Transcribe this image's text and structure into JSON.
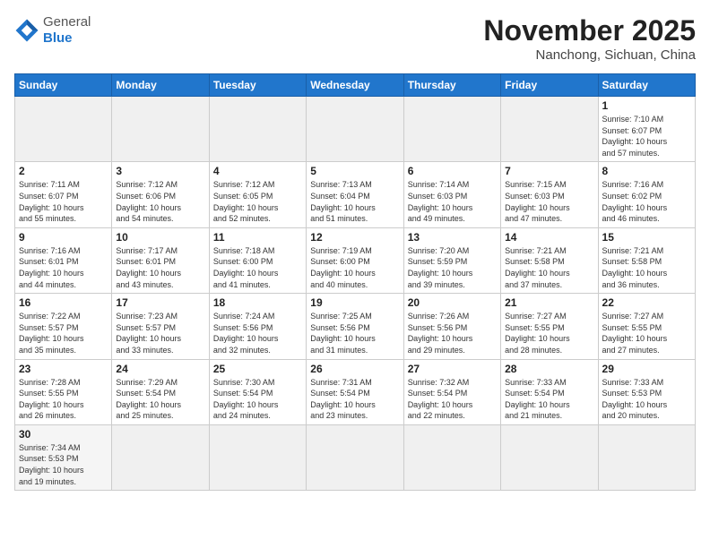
{
  "header": {
    "logo_general": "General",
    "logo_blue": "Blue",
    "month_title": "November 2025",
    "location": "Nanchong, Sichuan, China"
  },
  "weekdays": [
    "Sunday",
    "Monday",
    "Tuesday",
    "Wednesday",
    "Thursday",
    "Friday",
    "Saturday"
  ],
  "weeks": [
    [
      {
        "num": "",
        "info": ""
      },
      {
        "num": "",
        "info": ""
      },
      {
        "num": "",
        "info": ""
      },
      {
        "num": "",
        "info": ""
      },
      {
        "num": "",
        "info": ""
      },
      {
        "num": "",
        "info": ""
      },
      {
        "num": "1",
        "info": "Sunrise: 7:10 AM\nSunset: 6:07 PM\nDaylight: 10 hours\nand 57 minutes."
      }
    ],
    [
      {
        "num": "2",
        "info": "Sunrise: 7:11 AM\nSunset: 6:07 PM\nDaylight: 10 hours\nand 55 minutes."
      },
      {
        "num": "3",
        "info": "Sunrise: 7:12 AM\nSunset: 6:06 PM\nDaylight: 10 hours\nand 54 minutes."
      },
      {
        "num": "4",
        "info": "Sunrise: 7:12 AM\nSunset: 6:05 PM\nDaylight: 10 hours\nand 52 minutes."
      },
      {
        "num": "5",
        "info": "Sunrise: 7:13 AM\nSunset: 6:04 PM\nDaylight: 10 hours\nand 51 minutes."
      },
      {
        "num": "6",
        "info": "Sunrise: 7:14 AM\nSunset: 6:03 PM\nDaylight: 10 hours\nand 49 minutes."
      },
      {
        "num": "7",
        "info": "Sunrise: 7:15 AM\nSunset: 6:03 PM\nDaylight: 10 hours\nand 47 minutes."
      },
      {
        "num": "8",
        "info": "Sunrise: 7:16 AM\nSunset: 6:02 PM\nDaylight: 10 hours\nand 46 minutes."
      }
    ],
    [
      {
        "num": "9",
        "info": "Sunrise: 7:16 AM\nSunset: 6:01 PM\nDaylight: 10 hours\nand 44 minutes."
      },
      {
        "num": "10",
        "info": "Sunrise: 7:17 AM\nSunset: 6:01 PM\nDaylight: 10 hours\nand 43 minutes."
      },
      {
        "num": "11",
        "info": "Sunrise: 7:18 AM\nSunset: 6:00 PM\nDaylight: 10 hours\nand 41 minutes."
      },
      {
        "num": "12",
        "info": "Sunrise: 7:19 AM\nSunset: 6:00 PM\nDaylight: 10 hours\nand 40 minutes."
      },
      {
        "num": "13",
        "info": "Sunrise: 7:20 AM\nSunset: 5:59 PM\nDaylight: 10 hours\nand 39 minutes."
      },
      {
        "num": "14",
        "info": "Sunrise: 7:21 AM\nSunset: 5:58 PM\nDaylight: 10 hours\nand 37 minutes."
      },
      {
        "num": "15",
        "info": "Sunrise: 7:21 AM\nSunset: 5:58 PM\nDaylight: 10 hours\nand 36 minutes."
      }
    ],
    [
      {
        "num": "16",
        "info": "Sunrise: 7:22 AM\nSunset: 5:57 PM\nDaylight: 10 hours\nand 35 minutes."
      },
      {
        "num": "17",
        "info": "Sunrise: 7:23 AM\nSunset: 5:57 PM\nDaylight: 10 hours\nand 33 minutes."
      },
      {
        "num": "18",
        "info": "Sunrise: 7:24 AM\nSunset: 5:56 PM\nDaylight: 10 hours\nand 32 minutes."
      },
      {
        "num": "19",
        "info": "Sunrise: 7:25 AM\nSunset: 5:56 PM\nDaylight: 10 hours\nand 31 minutes."
      },
      {
        "num": "20",
        "info": "Sunrise: 7:26 AM\nSunset: 5:56 PM\nDaylight: 10 hours\nand 29 minutes."
      },
      {
        "num": "21",
        "info": "Sunrise: 7:27 AM\nSunset: 5:55 PM\nDaylight: 10 hours\nand 28 minutes."
      },
      {
        "num": "22",
        "info": "Sunrise: 7:27 AM\nSunset: 5:55 PM\nDaylight: 10 hours\nand 27 minutes."
      }
    ],
    [
      {
        "num": "23",
        "info": "Sunrise: 7:28 AM\nSunset: 5:55 PM\nDaylight: 10 hours\nand 26 minutes."
      },
      {
        "num": "24",
        "info": "Sunrise: 7:29 AM\nSunset: 5:54 PM\nDaylight: 10 hours\nand 25 minutes."
      },
      {
        "num": "25",
        "info": "Sunrise: 7:30 AM\nSunset: 5:54 PM\nDaylight: 10 hours\nand 24 minutes."
      },
      {
        "num": "26",
        "info": "Sunrise: 7:31 AM\nSunset: 5:54 PM\nDaylight: 10 hours\nand 23 minutes."
      },
      {
        "num": "27",
        "info": "Sunrise: 7:32 AM\nSunset: 5:54 PM\nDaylight: 10 hours\nand 22 minutes."
      },
      {
        "num": "28",
        "info": "Sunrise: 7:33 AM\nSunset: 5:54 PM\nDaylight: 10 hours\nand 21 minutes."
      },
      {
        "num": "29",
        "info": "Sunrise: 7:33 AM\nSunset: 5:53 PM\nDaylight: 10 hours\nand 20 minutes."
      }
    ],
    [
      {
        "num": "30",
        "info": "Sunrise: 7:34 AM\nSunset: 5:53 PM\nDaylight: 10 hours\nand 19 minutes."
      },
      {
        "num": "",
        "info": ""
      },
      {
        "num": "",
        "info": ""
      },
      {
        "num": "",
        "info": ""
      },
      {
        "num": "",
        "info": ""
      },
      {
        "num": "",
        "info": ""
      },
      {
        "num": "",
        "info": ""
      }
    ]
  ]
}
